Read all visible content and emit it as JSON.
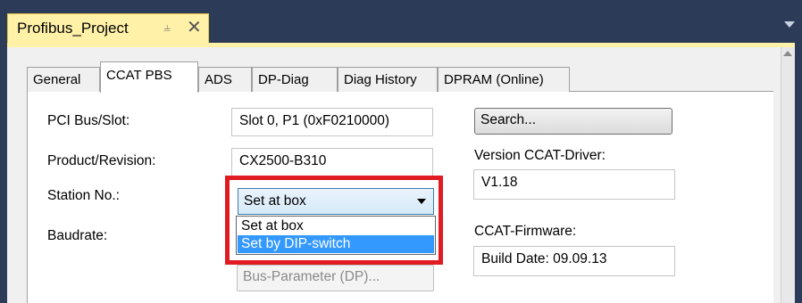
{
  "window": {
    "document_tab": "Profibus_Project",
    "pin_icon": "pin-icon",
    "close_icon": "close-icon"
  },
  "tabs": [
    {
      "label": "General",
      "active": false
    },
    {
      "label": "CCAT PBS",
      "active": true
    },
    {
      "label": "ADS",
      "active": false
    },
    {
      "label": "DP-Diag",
      "active": false
    },
    {
      "label": "Diag History",
      "active": false
    },
    {
      "label": "DPRAM (Online)",
      "active": false
    }
  ],
  "form": {
    "pci_label": "PCI Bus/Slot:",
    "pci_value": "Slot 0, P1 (0xF0210000)",
    "product_label": "Product/Revision:",
    "product_value": "CX2500-B310",
    "station_label": "Station No.:",
    "station_selected": "Set at box",
    "station_options": [
      "Set at box",
      "Set by DIP-switch"
    ],
    "baudrate_label": "Baudrate:",
    "bus_param_button": "Bus-Parameter (DP)...",
    "search_button": "Search...",
    "driver_label": "Version CCAT-Driver:",
    "driver_value": "V1.18",
    "firmware_label": "CCAT-Firmware:",
    "firmware_value": "Build Date: 09.09.13"
  },
  "colors": {
    "titlebar": "#2b3b58",
    "active_doc_tab": "#fff1a8",
    "selection": "#3399ff",
    "highlight_frame": "#e01b22"
  }
}
